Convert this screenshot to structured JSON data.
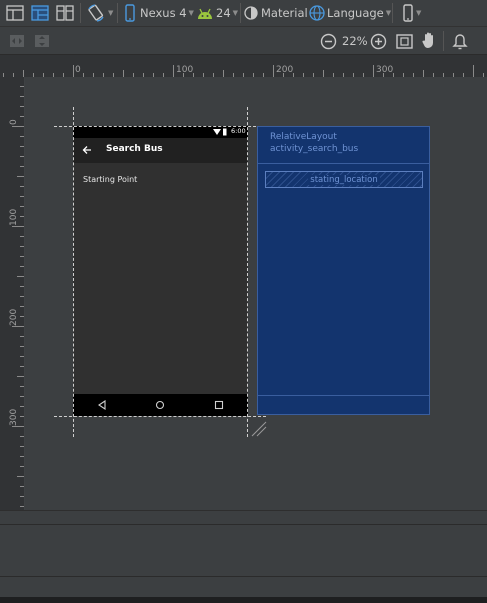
{
  "toolbar": {
    "device_label": "Nexus 4",
    "api_label": "24",
    "theme_label": "Material",
    "language_label": "Language"
  },
  "zoom": {
    "value_label": "22%"
  },
  "ruler": {
    "horizontal_ticks": [
      "0",
      "100",
      "200",
      "300"
    ],
    "vertical_ticks": [
      "0",
      "100",
      "200",
      "300"
    ]
  },
  "device": {
    "status_time": "6:00",
    "app_title": "Search Bus",
    "content_label": "Starting Point"
  },
  "blueprint": {
    "root_type": "RelativeLayout",
    "root_id": "activity_search_bus",
    "child_id": "stating_location"
  },
  "colors": {
    "canvas_bg": "#3c3f41",
    "blueprint_bg": "#13346e",
    "blueprint_text": "#6f93d4",
    "android_green": "#9ac53e",
    "accent_blue": "#4a9ae0"
  }
}
